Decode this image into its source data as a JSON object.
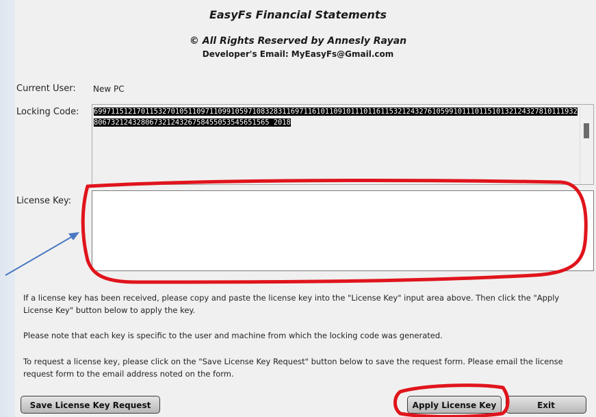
{
  "header": {
    "title": "EasyFs Financial Statements",
    "rights": "© All Rights Reserved by Annesly Rayan",
    "email": "Developer's Email: MyEasyFs@Gmail.com"
  },
  "fields": {
    "current_user_label": "Current User:",
    "current_user_value": "New PC",
    "locking_code_label": "Locking Code:",
    "locking_code_value": "6997115121701153270105110971109910597108328311697116101109101110116115321243276105991011101151013212432781011193280673212432806732124326758455053545651565 2018",
    "license_key_label": "License Key:",
    "license_key_value": ""
  },
  "instructions": {
    "p1": "If a license key has been received, please copy and paste the license key into the \"License Key\" input area above. Then click the \"Apply License Key\" button below to apply the key.",
    "p2": "Please note that each key is specific to the user and machine from which the locking code was generated.",
    "p3": "To  request a license key, please click on the \"Save License Key Request\" button below to save the request form. Please email the license request form to the email address noted on the form."
  },
  "buttons": {
    "save_request": "Save License Key Request",
    "apply": "Apply License Key",
    "exit": "Exit"
  },
  "annotation_colors": {
    "red_highlight": "#e0141c",
    "blue_arrow": "#4a78c2"
  }
}
